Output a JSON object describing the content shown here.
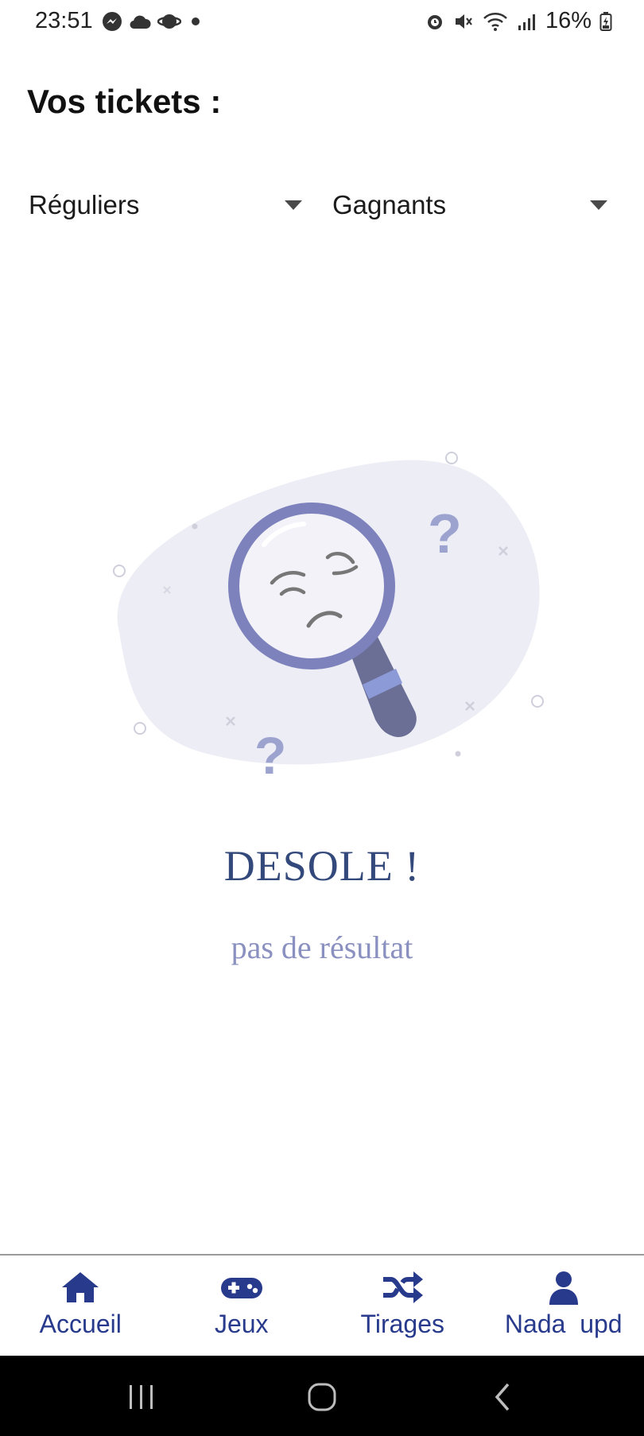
{
  "status_bar": {
    "time": "23:51",
    "battery": "16%",
    "left_icons": [
      "messenger-icon",
      "cloud-icon",
      "planet-icon",
      "dot-icon"
    ],
    "right_icons": [
      "alarm-icon",
      "mute-icon",
      "wifi-icon",
      "signal-icon",
      "battery-icon"
    ]
  },
  "page": {
    "title": "Vos tickets :"
  },
  "filters": {
    "type_selected": "Réguliers",
    "status_selected": "Gagnants"
  },
  "empty_state": {
    "title": "DESOLE !",
    "subtitle": "pas de résultat",
    "colors": {
      "title": "#34497b",
      "subtitle": "#8a90bf",
      "blob": "#ededf5",
      "lens": "#7d82bd",
      "handle": "#6b6f96"
    }
  },
  "bottom_nav": {
    "items": [
      {
        "label": "Accueil",
        "icon": "home-icon"
      },
      {
        "label": "Jeux",
        "icon": "gamepad-icon"
      },
      {
        "label": "Tirages",
        "icon": "shuffle-icon"
      },
      {
        "label": "Nada  upd",
        "icon": "user-icon"
      }
    ],
    "accent": "#283a8c"
  },
  "system_nav": {
    "icons": [
      "recent-apps-icon",
      "home-circle-icon",
      "back-icon"
    ]
  }
}
